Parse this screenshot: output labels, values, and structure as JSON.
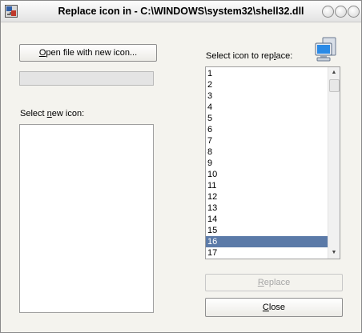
{
  "window": {
    "title": "Replace icon in - C:\\WINDOWS\\system32\\shell32.dll"
  },
  "left": {
    "open_button_prefix": "",
    "open_button_mnemonic": "O",
    "open_button_rest": "pen file with new icon...",
    "select_new_prefix": "Select ",
    "select_new_mnemonic": "n",
    "select_new_rest": "ew icon:"
  },
  "right": {
    "select_replace_prefix": "Select icon to rep",
    "select_replace_mnemonic": "l",
    "select_replace_rest": "ace:",
    "list": [
      "1",
      "2",
      "3",
      "4",
      "5",
      "6",
      "7",
      "8",
      "9",
      "10",
      "11",
      "12",
      "13",
      "14",
      "15",
      "16",
      "17"
    ],
    "selected_index": 15,
    "replace_mnemonic": "R",
    "replace_rest": "eplace",
    "close_mnemonic": "C",
    "close_rest": "lose"
  },
  "colors": {
    "selection": "#5b7aa8"
  },
  "icons": {
    "app": "app-icon",
    "computer": "computer-icon",
    "scroll_up": "chevron-up-icon",
    "scroll_down": "chevron-down-icon"
  }
}
